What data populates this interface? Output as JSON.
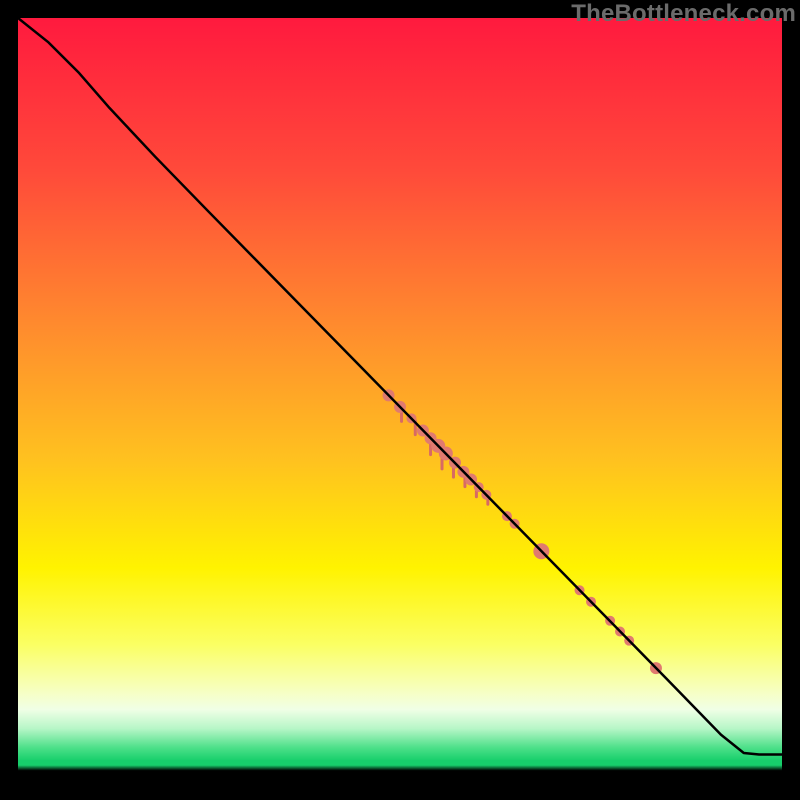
{
  "watermark": "TheBottleneck.com",
  "chart_data": {
    "type": "line",
    "title": "",
    "xlabel": "",
    "ylabel": "",
    "xlim": [
      0,
      100
    ],
    "ylim": [
      0,
      100
    ],
    "gradient_stops": [
      {
        "offset": 0.0,
        "color": "#ff1a3e"
      },
      {
        "offset": 0.2,
        "color": "#ff4a3a"
      },
      {
        "offset": 0.4,
        "color": "#ff8a2e"
      },
      {
        "offset": 0.58,
        "color": "#ffc21f"
      },
      {
        "offset": 0.72,
        "color": "#fff300"
      },
      {
        "offset": 0.82,
        "color": "#fbff63"
      },
      {
        "offset": 0.885,
        "color": "#f6ffc8"
      },
      {
        "offset": 0.905,
        "color": "#f0ffe6"
      },
      {
        "offset": 0.93,
        "color": "#b7f6c7"
      },
      {
        "offset": 0.955,
        "color": "#4de089"
      },
      {
        "offset": 0.972,
        "color": "#17cf6b"
      },
      {
        "offset": 0.978,
        "color": "#17cf6b"
      },
      {
        "offset": 0.985,
        "color": "#000000"
      },
      {
        "offset": 1.0,
        "color": "#000000"
      }
    ],
    "curve": [
      {
        "x": 0.0,
        "y": 100.0
      },
      {
        "x": 4.0,
        "y": 96.8
      },
      {
        "x": 8.0,
        "y": 92.8
      },
      {
        "x": 12.0,
        "y": 88.2
      },
      {
        "x": 18.0,
        "y": 81.8
      },
      {
        "x": 25.0,
        "y": 74.6
      },
      {
        "x": 35.0,
        "y": 64.4
      },
      {
        "x": 45.0,
        "y": 54.2
      },
      {
        "x": 55.0,
        "y": 44.0
      },
      {
        "x": 65.0,
        "y": 33.8
      },
      {
        "x": 75.0,
        "y": 23.6
      },
      {
        "x": 85.0,
        "y": 13.4
      },
      {
        "x": 92.0,
        "y": 6.2
      },
      {
        "x": 95.0,
        "y": 3.8
      },
      {
        "x": 97.0,
        "y": 3.6
      },
      {
        "x": 100.0,
        "y": 3.6
      }
    ],
    "color_curve": "#000000",
    "points": [
      {
        "x": 48.5,
        "y": 50.6,
        "r": 6
      },
      {
        "x": 50.0,
        "y": 49.1,
        "r": 6
      },
      {
        "x": 51.5,
        "y": 47.6,
        "r": 5
      },
      {
        "x": 53.0,
        "y": 46.0,
        "r": 6
      },
      {
        "x": 54.0,
        "y": 45.0,
        "r": 6
      },
      {
        "x": 55.0,
        "y": 44.0,
        "r": 7
      },
      {
        "x": 56.0,
        "y": 43.0,
        "r": 7
      },
      {
        "x": 57.2,
        "y": 41.8,
        "r": 6
      },
      {
        "x": 58.3,
        "y": 40.6,
        "r": 6
      },
      {
        "x": 59.3,
        "y": 39.6,
        "r": 6
      },
      {
        "x": 60.3,
        "y": 38.6,
        "r": 5
      },
      {
        "x": 61.3,
        "y": 37.6,
        "r": 5
      },
      {
        "x": 64.0,
        "y": 34.8,
        "r": 5
      },
      {
        "x": 65.0,
        "y": 33.8,
        "r": 5
      },
      {
        "x": 68.5,
        "y": 30.2,
        "r": 8
      },
      {
        "x": 73.5,
        "y": 25.1,
        "r": 5
      },
      {
        "x": 75.0,
        "y": 23.6,
        "r": 5
      },
      {
        "x": 77.5,
        "y": 21.1,
        "r": 5
      },
      {
        "x": 78.8,
        "y": 19.7,
        "r": 5
      },
      {
        "x": 80.0,
        "y": 18.5,
        "r": 5
      },
      {
        "x": 83.5,
        "y": 14.9,
        "r": 6
      }
    ],
    "point_color": "#e07a6f",
    "tick_strokes": [
      {
        "x": 48.3,
        "y": 51.0,
        "len": 7
      },
      {
        "x": 50.2,
        "y": 49.3,
        "len": 16
      },
      {
        "x": 52.0,
        "y": 47.3,
        "len": 14
      },
      {
        "x": 54.0,
        "y": 45.2,
        "len": 18
      },
      {
        "x": 55.5,
        "y": 43.6,
        "len": 20
      },
      {
        "x": 57.0,
        "y": 42.0,
        "len": 16
      },
      {
        "x": 58.5,
        "y": 40.5,
        "len": 14
      },
      {
        "x": 60.0,
        "y": 38.9,
        "len": 12
      },
      {
        "x": 61.5,
        "y": 37.4,
        "len": 8
      }
    ],
    "tick_color": "#d86a63"
  }
}
